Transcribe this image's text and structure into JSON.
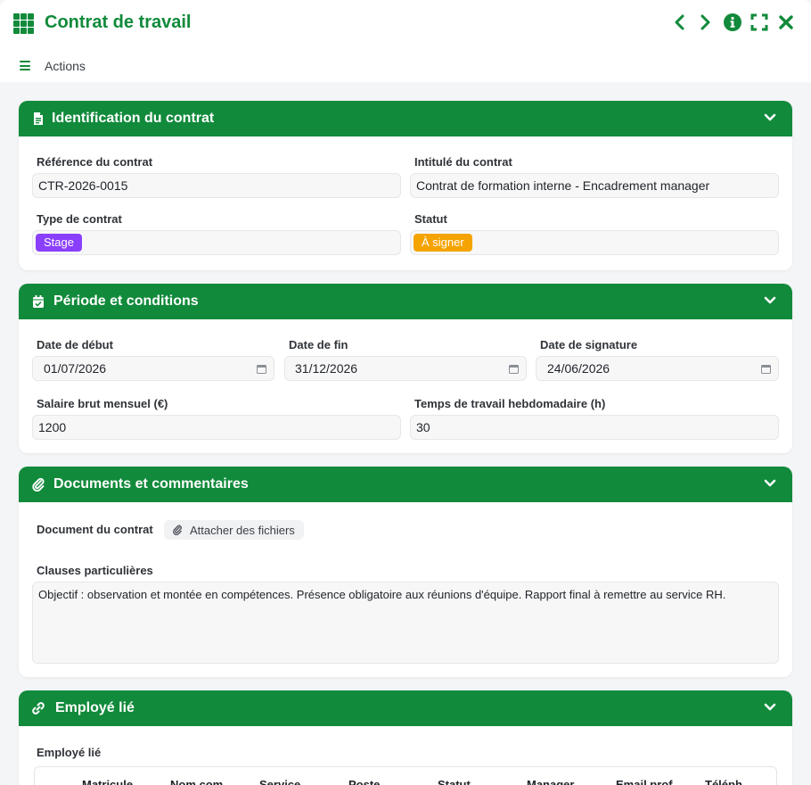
{
  "window": {
    "title": "Contrat de travail",
    "action_menu_label": "Actions"
  },
  "sections": {
    "identification": {
      "title": "Identification du contrat",
      "reference_label": "Référence du contrat",
      "reference_value": "CTR-2026-0015",
      "intitule_label": "Intitulé du contrat",
      "intitule_value": "Contrat de formation interne - Encadrement manager",
      "type_label": "Type de contrat",
      "type_value": "Stage",
      "statut_label": "Statut",
      "statut_value": "À signer"
    },
    "periode": {
      "title": "Période et conditions",
      "date_debut_label": "Date de début",
      "date_debut_value": "01/07/2026",
      "date_fin_label": "Date de fin",
      "date_fin_value": "31/12/2026",
      "date_signature_label": "Date de signature",
      "date_signature_value": "24/06/2026",
      "salaire_label": "Salaire brut mensuel (€)",
      "salaire_value": "1200",
      "temps_label": "Temps de travail hebdomadaire (h)",
      "temps_value": "30"
    },
    "documents": {
      "title": "Documents et commentaires",
      "document_label": "Document du contrat",
      "attach_button_label": "Attacher des fichiers",
      "clauses_label": "Clauses particulières",
      "clauses_value": "Objectif : observation et montée en compétences. Présence obligatoire aux réunions d'équipe. Rapport final à remettre au service RH."
    },
    "employe": {
      "title": "Employé lié",
      "field_label": "Employé lié",
      "columns": [
        "Matricule",
        "Nom com...",
        "Service",
        "Poste",
        "Statut",
        "Manager",
        "Email prof...",
        "Téléph..."
      ]
    }
  },
  "colors": {
    "brand_green": "#118a3b",
    "type_tag_purple": "#8a3ffc",
    "status_tag_amber": "#f5a300"
  }
}
